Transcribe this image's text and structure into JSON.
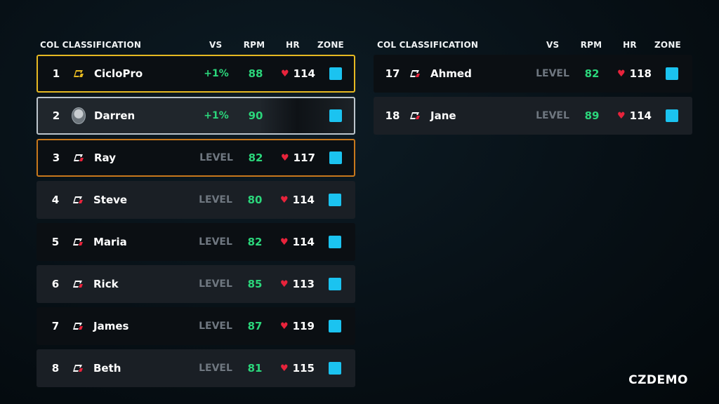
{
  "brand": "CZDEMO",
  "colors": {
    "accent_green": "#2bd67b",
    "zone_blue": "#1bc3f0",
    "heart_red": "#e8233b",
    "gold": "#e6b922",
    "silver": "#bcc5cc",
    "bronze": "#c8781c"
  },
  "headers": {
    "classification": "COL CLASSIFICATION",
    "vs": "VS",
    "rpm": "RPM",
    "hr": "HR",
    "zone": "ZONE"
  },
  "left_rows": [
    {
      "pos": "1",
      "name": "CicloPro",
      "vs": "+1%",
      "rpm": "88",
      "hr": "114",
      "icon": "team-logo-gold-icon",
      "style": "gold"
    },
    {
      "pos": "2",
      "name": "Darren",
      "vs": "+1%",
      "rpm": "90",
      "hr": "",
      "icon": "avatar",
      "style": "silver"
    },
    {
      "pos": "3",
      "name": "Ray",
      "vs": "LEVEL",
      "rpm": "82",
      "hr": "117",
      "icon": "team-logo-icon",
      "style": "bronze"
    },
    {
      "pos": "4",
      "name": "Steve",
      "vs": "LEVEL",
      "rpm": "80",
      "hr": "114",
      "icon": "team-logo-icon",
      "style": "light"
    },
    {
      "pos": "5",
      "name": "Maria",
      "vs": "LEVEL",
      "rpm": "82",
      "hr": "114",
      "icon": "team-logo-icon",
      "style": "dark"
    },
    {
      "pos": "6",
      "name": "Rick",
      "vs": "LEVEL",
      "rpm": "85",
      "hr": "113",
      "icon": "team-logo-icon",
      "style": "light"
    },
    {
      "pos": "7",
      "name": "James",
      "vs": "LEVEL",
      "rpm": "87",
      "hr": "119",
      "icon": "team-logo-icon",
      "style": "dark"
    },
    {
      "pos": "8",
      "name": "Beth",
      "vs": "LEVEL",
      "rpm": "81",
      "hr": "115",
      "icon": "team-logo-icon",
      "style": "light"
    }
  ],
  "right_rows": [
    {
      "pos": "17",
      "name": "Ahmed",
      "vs": "LEVEL",
      "rpm": "82",
      "hr": "118",
      "icon": "team-logo-icon",
      "style": "dark"
    },
    {
      "pos": "18",
      "name": "Jane",
      "vs": "LEVEL",
      "rpm": "89",
      "hr": "114",
      "icon": "team-logo-icon",
      "style": "light"
    }
  ]
}
